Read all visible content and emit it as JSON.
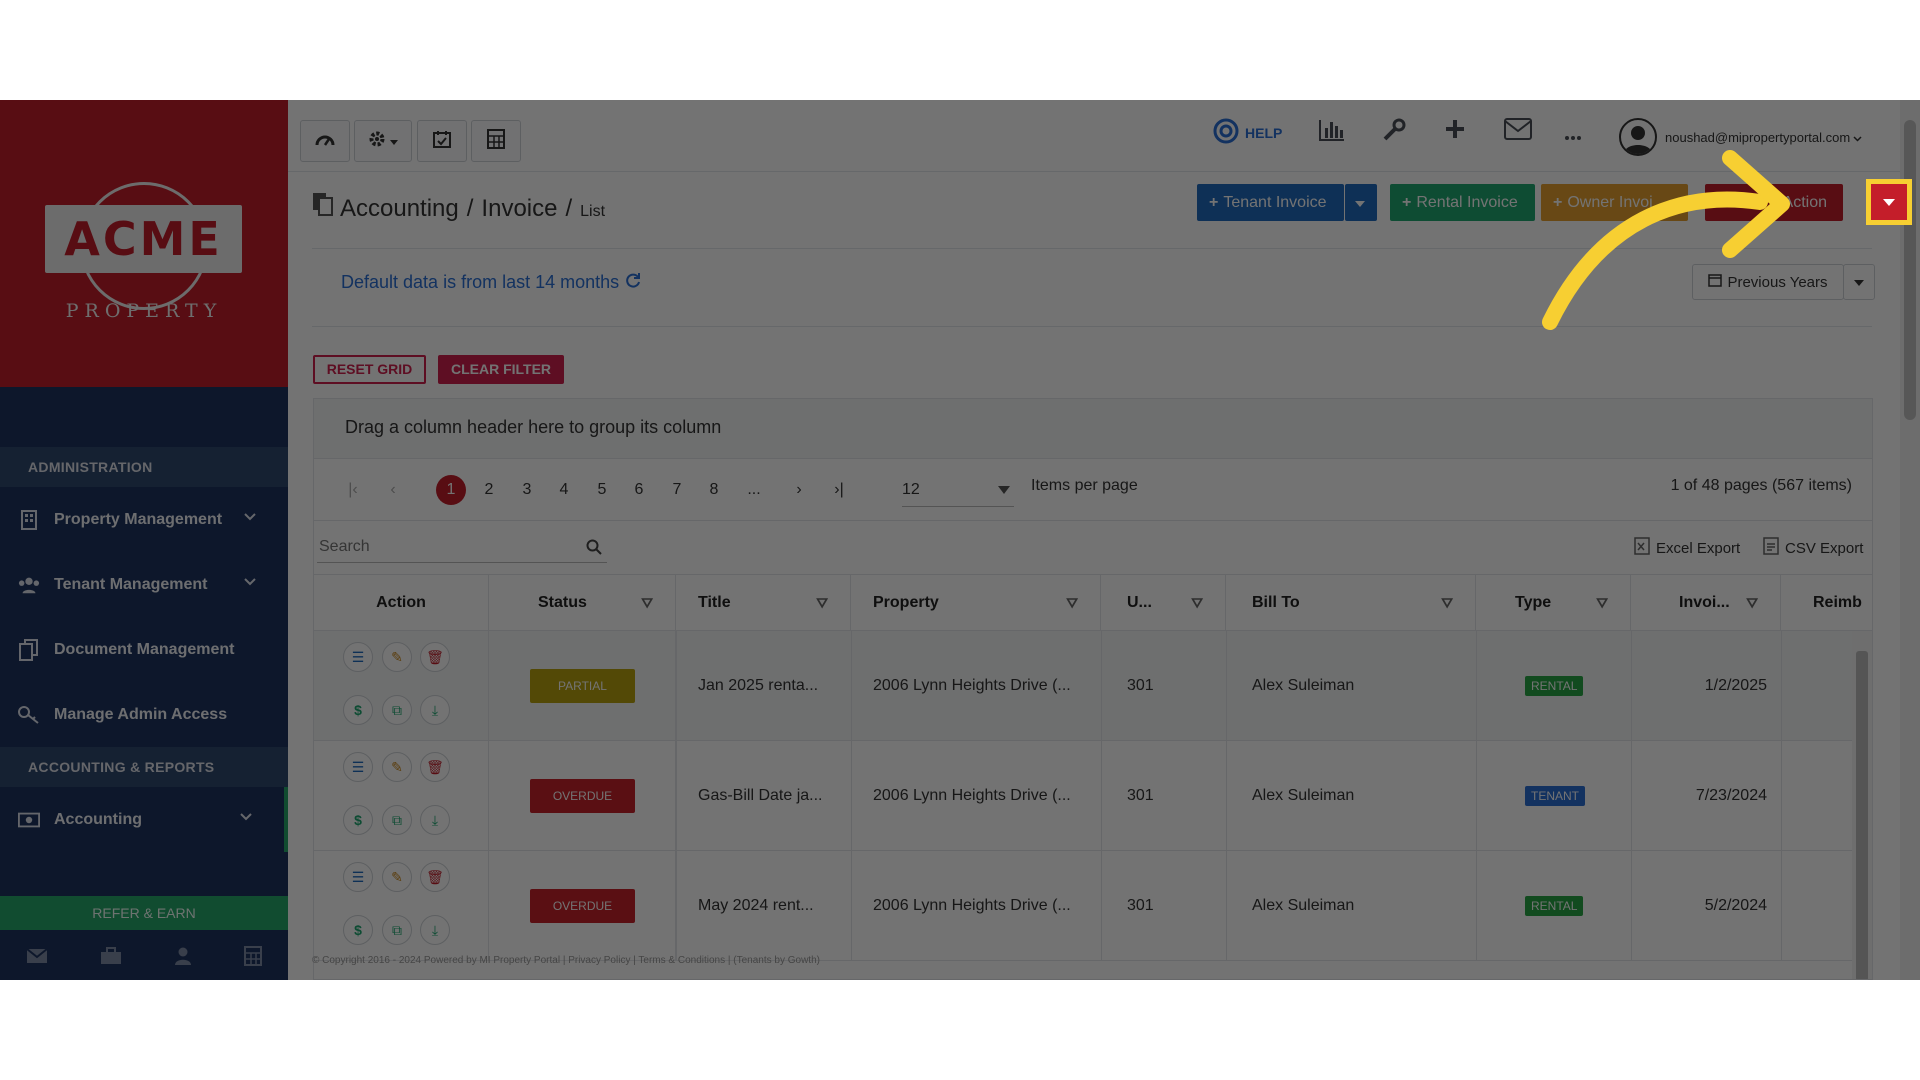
{
  "sidebar": {
    "logo_text": "ACME",
    "logo_sub": "PROPERTY",
    "admin_header": "ADMINISTRATION",
    "items": [
      {
        "label": "Property Management"
      },
      {
        "label": "Tenant Management"
      },
      {
        "label": "Document Management"
      },
      {
        "label": "Manage Admin Access"
      }
    ],
    "accounting_header": "ACCOUNTING & REPORTS",
    "accounting_item": "Accounting",
    "refer_label": "REFER & EARN"
  },
  "topbar": {
    "help_label": "HELP",
    "user_email": "noushad@mipropertyportal.com"
  },
  "page": {
    "breadcrumb_1": "Accounting",
    "sep": "/",
    "breadcrumb_2": "Invoice",
    "breadcrumb_3": "List",
    "default_note": "Default data is from last 14 months",
    "previous_years": "Previous Years",
    "buttons": {
      "tenant_invoice": "Tenant Invoice",
      "rental_invoice": "Rental Invoice",
      "owner_invoice": "Owner Invoi",
      "action": "Action"
    },
    "reset_grid": "RESET GRID",
    "clear_filter": "CLEAR FILTER",
    "group_hint": "Drag a column header here to group its column",
    "pager": {
      "pages": [
        "1",
        "2",
        "3",
        "4",
        "5",
        "6",
        "7",
        "8",
        "..."
      ],
      "current": "1",
      "items_per_page_value": "12",
      "items_per_page_label": "Items per page",
      "summary": "1 of 48 pages (567 items)"
    },
    "search_placeholder": "Search",
    "excel_export": "Excel Export",
    "csv_export": "CSV Export",
    "columns": [
      "Action",
      "Status",
      "Title",
      "Property",
      "U...",
      "Bill To",
      "Type",
      "Invoi...",
      "Reimb"
    ],
    "rows": [
      {
        "status": "PARTIAL",
        "status_color": "#b8a30e",
        "title": "Jan 2025 renta...",
        "property": "2006 Lynn Heights Drive (...",
        "unit": "301",
        "bill_to": "Alex Suleiman",
        "type": "RENTAL",
        "type_color": "#28a745",
        "invoice_date": "1/2/2025"
      },
      {
        "status": "OVERDUE",
        "status_color": "#c8232c",
        "title": "Gas-Bill Date ja...",
        "property": "2006 Lynn Heights Drive (...",
        "unit": "301",
        "bill_to": "Alex Suleiman",
        "type": "TENANT",
        "type_color": "#2a6fd6",
        "invoice_date": "7/23/2024"
      },
      {
        "status": "OVERDUE",
        "status_color": "#c8232c",
        "title": "May 2024 rent...",
        "property": "2006 Lynn Heights Drive (...",
        "unit": "301",
        "bill_to": "Alex Suleiman",
        "type": "RENTAL",
        "type_color": "#28a745",
        "invoice_date": "5/2/2024"
      }
    ],
    "footer": "© Copyright 2016 - 2024 Powered by MI Property Portal | Privacy Policy | Terms & Conditions | (Tenants by Gowth)"
  },
  "colors": {
    "brand_red": "#c41e2a",
    "sidebar_navy": "#1e3461",
    "highlight_yellow": "#f7cf32",
    "tenant_btn": "#1f6bbf",
    "rental_btn": "#1fa872",
    "owner_btn": "#e6a12f",
    "clear_filter": "#d0214e"
  }
}
